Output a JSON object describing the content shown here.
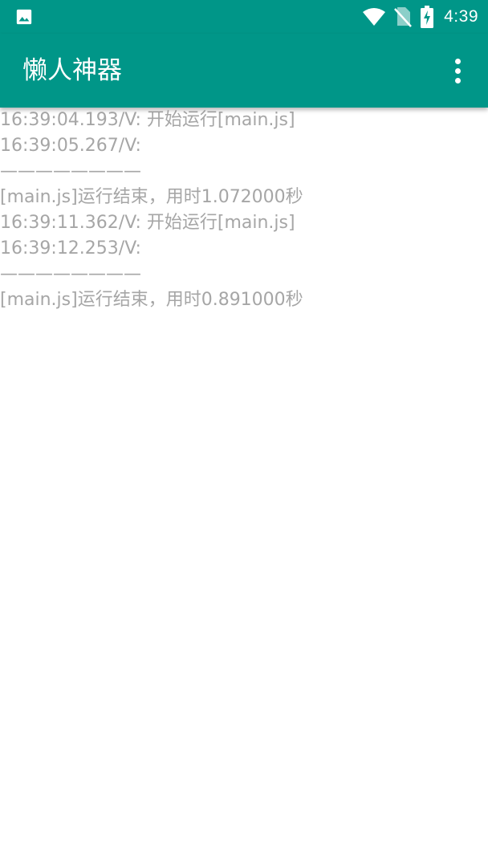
{
  "status_bar": {
    "time": "4:39",
    "icons": [
      "image-icon",
      "wifi-icon",
      "no-sim-icon",
      "battery-charging-icon"
    ]
  },
  "app_bar": {
    "title": "懒人神器",
    "menu_icon": "overflow-menu-icon"
  },
  "log": {
    "lines": [
      "16:39:04.193/V: 开始运行[main.js]",
      "16:39:05.267/V:",
      "————————",
      "[main.js]运行结束，用时1.072000秒",
      "16:39:11.362/V: 开始运行[main.js]",
      "16:39:12.253/V:",
      "————————",
      "[main.js]运行结束，用时0.891000秒"
    ]
  },
  "colors": {
    "primary": "#009688",
    "log_text": "#a6a6a6",
    "background": "#ffffff"
  }
}
